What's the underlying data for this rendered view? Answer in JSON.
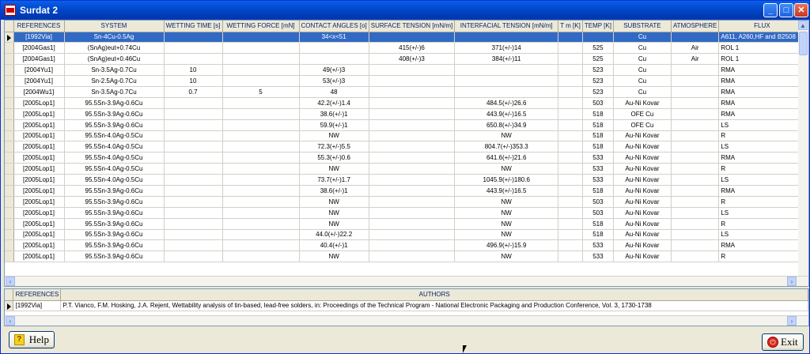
{
  "window": {
    "title": "Surdat 2"
  },
  "main_grid": {
    "columns": [
      "REFERENCES",
      "SYSTEM",
      "WETTING TIME [s]",
      "WETTING FORCE [mN]",
      "CONTACT ANGLES [o]",
      "SURFACE TENSION [mN/m]",
      "INTERFACIAL TENSION [mN/m]",
      "T m [K]",
      "TEMP [K]",
      "SUBSTRATE",
      "ATMOSPHERE",
      "FLUX"
    ],
    "selected_index": 0,
    "rows": [
      [
        "[1992Via]",
        "Sn-4Cu-0.5Ag",
        "",
        "",
        "34<x<51",
        "",
        "",
        "",
        "",
        "Cu",
        "",
        "A611, A260,HF and B2508"
      ],
      [
        "[2004Gas1]",
        "(SnAg)eut+0.74Cu",
        "",
        "",
        "",
        "415(+/-)6",
        "371(+/-)14",
        "",
        "525",
        "Cu",
        "Air",
        "ROL 1"
      ],
      [
        "[2004Gas1]",
        "(SnAg)eut+0.46Cu",
        "",
        "",
        "",
        "408(+/-)3",
        "384(+/-)11",
        "",
        "525",
        "Cu",
        "Air",
        "ROL 1"
      ],
      [
        "[2004Yu1]",
        "Sn-3.5Ag-0.7Cu",
        "10",
        "",
        "49(+/-)3",
        "",
        "",
        "",
        "523",
        "Cu",
        "",
        "RMA"
      ],
      [
        "[2004Yu1]",
        "Sn-2.5Ag-0.7Cu",
        "10",
        "",
        "53(+/-)3",
        "",
        "",
        "",
        "523",
        "Cu",
        "",
        "RMA"
      ],
      [
        "[2004Wu1]",
        "Sn-3.5Ag-0.7Cu",
        "0.7",
        "5",
        "48",
        "",
        "",
        "",
        "523",
        "Cu",
        "",
        "RMA"
      ],
      [
        "[2005Lop1]",
        "95.5Sn-3.9Ag-0.6Cu",
        "",
        "",
        "42.2(+/-)1.4",
        "",
        "484.5(+/-)26.6",
        "",
        "503",
        "Au-Ni Kovar",
        "",
        "RMA"
      ],
      [
        "[2005Lop1]",
        "95.5Sn-3.9Ag-0.6Cu",
        "",
        "",
        "38.6(+/-)1",
        "",
        "443.9(+/-)16.5",
        "",
        "518",
        "OFE Cu",
        "",
        "RMA"
      ],
      [
        "[2005Lop1]",
        "95.5Sn-3.9Ag-0.6Cu",
        "",
        "",
        "59.9(+/-)1",
        "",
        "650.8(+/-)34.9",
        "",
        "518",
        "OFE Cu",
        "",
        "LS"
      ],
      [
        "[2005Lop1]",
        "95.5Sn-4.0Ag-0.5Cu",
        "",
        "",
        "NW",
        "",
        "NW",
        "",
        "518",
        "Au-Ni Kovar",
        "",
        "R"
      ],
      [
        "[2005Lop1]",
        "95.5Sn-4.0Ag-0.5Cu",
        "",
        "",
        "72.3(+/-)5.5",
        "",
        "804.7(+/-)353.3",
        "",
        "518",
        "Au-Ni Kovar",
        "",
        "LS"
      ],
      [
        "[2005Lop1]",
        "95.5Sn-4.0Ag-0.5Cu",
        "",
        "",
        "55.3(+/-)0.6",
        "",
        "641.6(+/-)21.6",
        "",
        "533",
        "Au-Ni Kovar",
        "",
        "RMA"
      ],
      [
        "[2005Lop1]",
        "95.5Sn-4.0Ag-0.5Cu",
        "",
        "",
        "NW",
        "",
        "NW",
        "",
        "533",
        "Au-Ni Kovar",
        "",
        "R"
      ],
      [
        "[2005Lop1]",
        "95.5Sn-4.0Ag-0.5Cu",
        "",
        "",
        "73.7(+/-)1.7",
        "",
        "1045.9(+/-)180.6",
        "",
        "533",
        "Au-Ni Kovar",
        "",
        "LS"
      ],
      [
        "[2005Lop1]",
        "95.5Sn-3.9Ag-0.6Cu",
        "",
        "",
        "38.6(+/-)1",
        "",
        "443.9(+/-)16.5",
        "",
        "518",
        "Au-Ni Kovar",
        "",
        "RMA"
      ],
      [
        "[2005Lop1]",
        "95.5Sn-3.9Ag-0.6Cu",
        "",
        "",
        "NW",
        "",
        "NW",
        "",
        "503",
        "Au-Ni Kovar",
        "",
        "R"
      ],
      [
        "[2005Lop1]",
        "95.5Sn-3.9Ag-0.6Cu",
        "",
        "",
        "NW",
        "",
        "NW",
        "",
        "503",
        "Au-Ni Kovar",
        "",
        "LS"
      ],
      [
        "[2005Lop1]",
        "95.5Sn-3.9Ag-0.6Cu",
        "",
        "",
        "NW",
        "",
        "NW",
        "",
        "518",
        "Au-Ni Kovar",
        "",
        "R"
      ],
      [
        "[2005Lop1]",
        "95.5Sn-3.9Ag-0.6Cu",
        "",
        "",
        "44.0(+/-)22.2",
        "",
        "NW",
        "",
        "518",
        "Au-Ni Kovar",
        "",
        "LS"
      ],
      [
        "[2005Lop1]",
        "95.5Sn-3.9Ag-0.6Cu",
        "",
        "",
        "40.4(+/-)1",
        "",
        "496.9(+/-)15.9",
        "",
        "533",
        "Au-Ni Kovar",
        "",
        "RMA"
      ],
      [
        "[2005Lop1]",
        "95.5Sn-3.9Ag-0.6Cu",
        "",
        "",
        "NW",
        "",
        "NW",
        "",
        "533",
        "Au-Ni Kovar",
        "",
        "R"
      ]
    ]
  },
  "authors_grid": {
    "columns": [
      "REFERENCES",
      "AUTHORS"
    ],
    "rows": [
      [
        "[1992Via]",
        "P.T. Vianco, F.M. Hosking, J.A. Rejent, Wettability analysis of tin-based, lead-free solders, in: Proceedings of the Technical Program - National Electronic Packaging and Production Conference, Vol. 3, 1730-1738"
      ]
    ]
  },
  "buttons": {
    "help": "Help",
    "exit": "Exit"
  },
  "colors": {
    "selection": "#316ac5",
    "titlebar": "#0147c9"
  }
}
